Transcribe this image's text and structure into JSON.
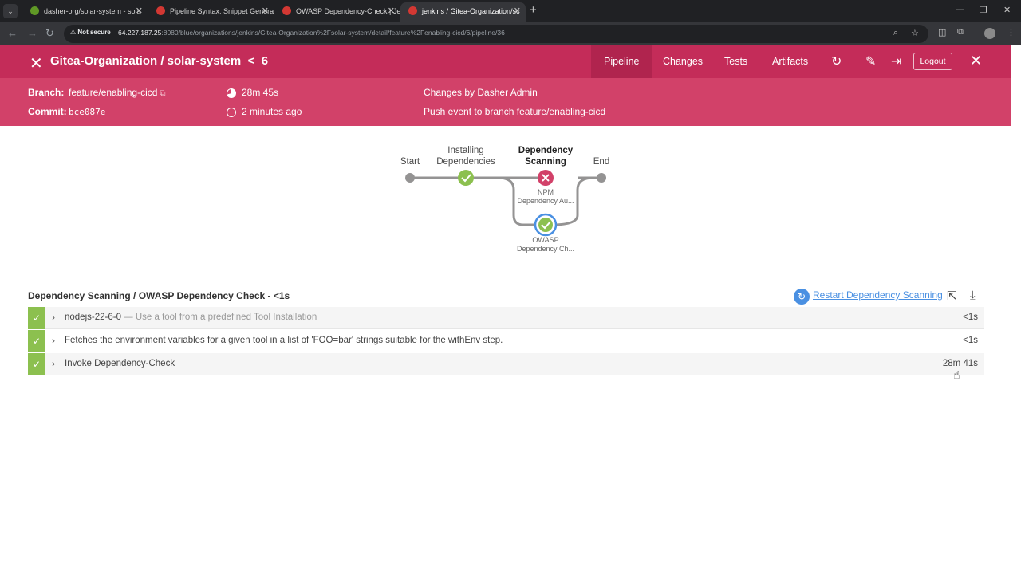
{
  "browser": {
    "tabs": [
      {
        "title": "dasher-org/solar-system - sola",
        "active": false,
        "favicon_color": "#609926"
      },
      {
        "title": "Pipeline Syntax: Snippet Genera",
        "active": false,
        "favicon_color": "#d33833"
      },
      {
        "title": "OWASP Dependency-Check | Je",
        "active": false,
        "favicon_color": "#d33833"
      },
      {
        "title": "jenkins / Gitea-Organization/sc",
        "active": true,
        "favicon_color": "#d33833"
      }
    ],
    "not_secure_label": "Not secure",
    "url_host": "64.227.187.25",
    "url_rest": ":8080/blue/organizations/jenkins/Gitea-Organization%2Fsolar-system/detail/feature%2Fenabling-cicd/6/pipeline/36"
  },
  "header": {
    "title": "Gitea-Organization / solar-system",
    "run_prefix": "<",
    "run_number": "6",
    "nav": [
      {
        "label": "Pipeline",
        "active": true
      },
      {
        "label": "Changes",
        "active": false
      },
      {
        "label": "Tests",
        "active": false
      },
      {
        "label": "Artifacts",
        "active": false
      }
    ],
    "logout_label": "Logout"
  },
  "meta": {
    "branch_label": "Branch:",
    "branch_value": "feature/enabling-cicd",
    "commit_label": "Commit:",
    "commit_value": "bce087e",
    "duration": "28m 45s",
    "ago": "2 minutes ago",
    "changes_by": "Changes by Dasher Admin",
    "trigger": "Push event to branch feature/enabling-cicd"
  },
  "pipeline": {
    "start": "Start",
    "installing_1": "Installing",
    "installing_2": "Dependencies",
    "scanning_1": "Dependency",
    "scanning_2": "Scanning",
    "end": "End",
    "npm_1": "NPM",
    "npm_2": "Dependency Au...",
    "owasp_1": "OWASP",
    "owasp_2": "Dependency Ch...",
    "colors": {
      "success": "#8cc04f",
      "failure": "#d24169",
      "selected_ring": "#4a90e2",
      "line": "#949393"
    }
  },
  "steps": {
    "title": "Dependency Scanning / OWASP Dependency Check - <1s",
    "restart_label": "Restart Dependency Scanning",
    "rows": [
      {
        "name": "nodejs-22-6-0",
        "desc": " — Use a tool from a predefined Tool Installation",
        "duration": "<1s"
      },
      {
        "name": "Fetches the environment variables for a given tool in a list of 'FOO=bar' strings suitable for the withEnv step.",
        "desc": "",
        "duration": "<1s"
      },
      {
        "name": "Invoke Dependency-Check",
        "desc": "",
        "duration": "28m 41s"
      }
    ]
  }
}
